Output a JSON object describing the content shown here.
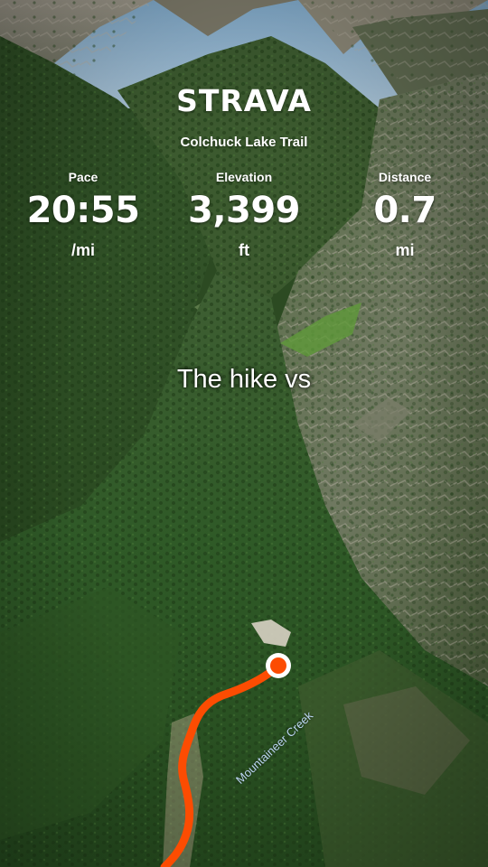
{
  "map": {
    "style": "3d-satellite-terrain",
    "route_color": "#fc4c02",
    "end_marker_color": "#fc4c02",
    "water_label_color": "#bcd6f2",
    "water_label": "Mountaineer Creek"
  },
  "header": {
    "brand": "STRAVA",
    "trail_name": "Colchuck Lake Trail"
  },
  "stats": {
    "pace": {
      "label": "Pace",
      "value": "20:55",
      "unit": "/mi"
    },
    "elevation": {
      "label": "Elevation",
      "value": "3,399",
      "unit": "ft"
    },
    "distance": {
      "label": "Distance",
      "value": "0.7",
      "unit": "mi"
    }
  },
  "caption": "The hike vs"
}
